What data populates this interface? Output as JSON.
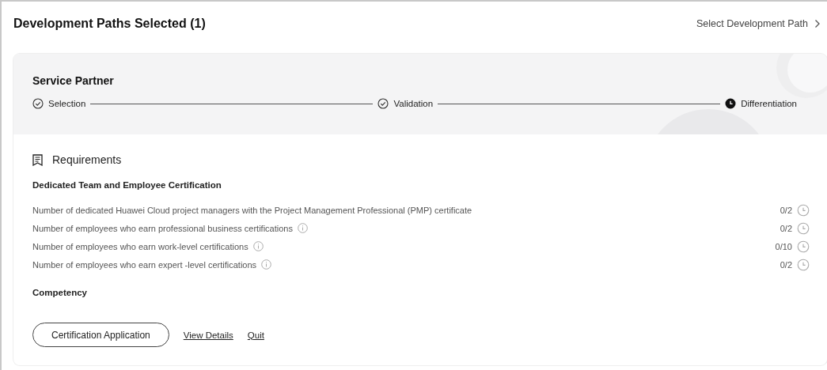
{
  "header": {
    "title": "Development Paths Selected (1)",
    "link": "Select Development Path"
  },
  "path": {
    "name": "Service Partner",
    "steps": [
      {
        "label": "Selection",
        "kind": "done"
      },
      {
        "label": "Validation",
        "kind": "done"
      },
      {
        "label": "Differentiation",
        "kind": "current"
      }
    ]
  },
  "requirements": {
    "title": "Requirements",
    "sections": [
      {
        "title": "Dedicated Team and Employee Certification",
        "items": [
          {
            "label": "Number of dedicated Huawei Cloud project managers with the Project Management Professional (PMP) certificate",
            "info": false,
            "value": "0/2"
          },
          {
            "label": "Number of employees who earn professional business certifications",
            "info": true,
            "value": "0/2"
          },
          {
            "label": "Number of employees who earn work-level certifications",
            "info": true,
            "value": "0/10"
          },
          {
            "label": "Number of employees who earn expert -level certifications",
            "info": true,
            "value": "0/2"
          }
        ]
      },
      {
        "title": "Competency"
      }
    ]
  },
  "actions": {
    "primary": "Certification Application",
    "links": [
      "View Details",
      "Quit"
    ]
  }
}
